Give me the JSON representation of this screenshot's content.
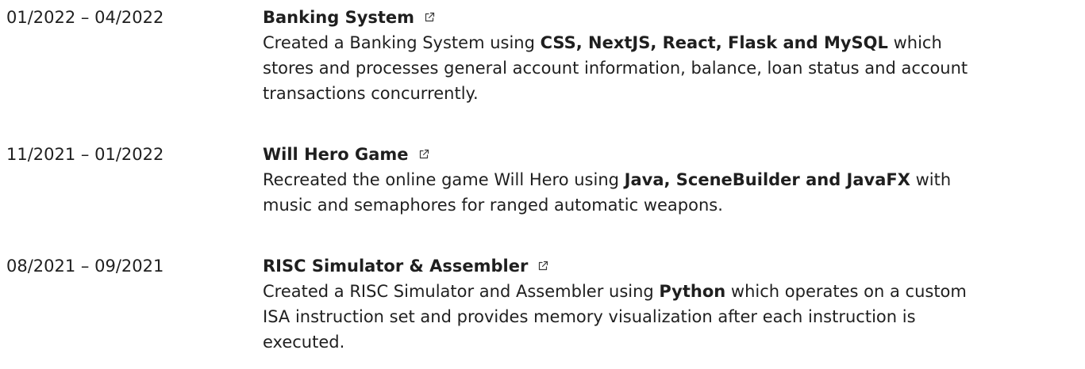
{
  "projects": [
    {
      "date": "01/2022 – 04/2022",
      "title": "Banking System",
      "link_icon": "external-link-icon",
      "desc": {
        "lines": [
          [
            {
              "text": "Created a Banking System using ",
              "bold": false
            },
            {
              "text": "CSS, NextJS, React, Flask and MySQL",
              "bold": true
            },
            {
              "text": " which",
              "bold": false
            }
          ],
          [
            {
              "text": "stores and processes general account information, balance, loan status and account",
              "bold": false
            }
          ],
          [
            {
              "text": "transactions concurrently.",
              "bold": false
            }
          ]
        ]
      }
    },
    {
      "date": "11/2021 – 01/2022",
      "title": "Will Hero Game",
      "link_icon": "external-link-icon",
      "desc": {
        "lines": [
          [
            {
              "text": "Recreated the online game Will Hero using ",
              "bold": false
            },
            {
              "text": "Java, SceneBuilder and JavaFX",
              "bold": true
            },
            {
              "text": " with",
              "bold": false
            }
          ],
          [
            {
              "text": "music and semaphores for ranged automatic weapons.",
              "bold": false
            }
          ]
        ]
      }
    },
    {
      "date": "08/2021 – 09/2021",
      "title": "RISC Simulator & Assembler",
      "link_icon": "external-link-icon",
      "desc": {
        "lines": [
          [
            {
              "text": "Created a RISC Simulator and Assembler using ",
              "bold": false
            },
            {
              "text": "Python",
              "bold": true
            },
            {
              "text": " which operates on a custom",
              "bold": false
            }
          ],
          [
            {
              "text": "ISA instruction set and provides memory visualization after each instruction is",
              "bold": false
            }
          ],
          [
            {
              "text": "executed.",
              "bold": false
            }
          ]
        ]
      }
    }
  ]
}
